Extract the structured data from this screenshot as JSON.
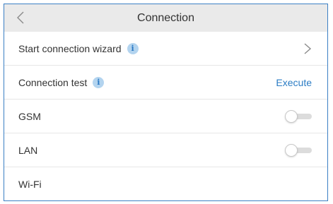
{
  "header": {
    "title": "Connection",
    "back_icon": "chevron-left-icon"
  },
  "rows": [
    {
      "label": "Start connection wizard",
      "info_icon": "i",
      "action": "chevron-right-icon"
    },
    {
      "label": "Connection test",
      "info_icon": "i",
      "action_label": "Execute"
    },
    {
      "label": "GSM",
      "toggle_on": false
    },
    {
      "label": "LAN",
      "toggle_on": false
    },
    {
      "label": "Wi-Fi"
    }
  ],
  "colors": {
    "accent": "#2b7cc4",
    "frame_border": "#3b7fc4",
    "header_bg": "#eaeaea",
    "info_bg": "#b3d4ef"
  }
}
